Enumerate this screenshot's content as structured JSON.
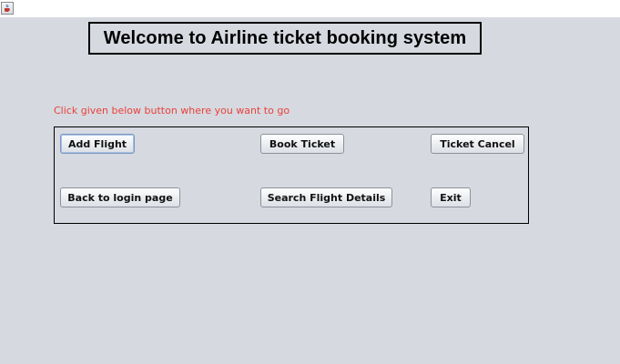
{
  "window": {
    "icon": "java-cup-icon"
  },
  "heading": "Welcome to Airline ticket booking system",
  "instruction": "Click given below button where you want to go",
  "buttons": {
    "add_flight": "Add Flight",
    "book_ticket": "Book Ticket",
    "ticket_cancel": "Ticket Cancel",
    "back_to_login": "Back to login page",
    "search_flight_details": "Search Flight Details",
    "exit": "Exit"
  },
  "colors": {
    "background": "#d6d9e0",
    "instruction_text": "#e8413a",
    "border": "#000000"
  }
}
